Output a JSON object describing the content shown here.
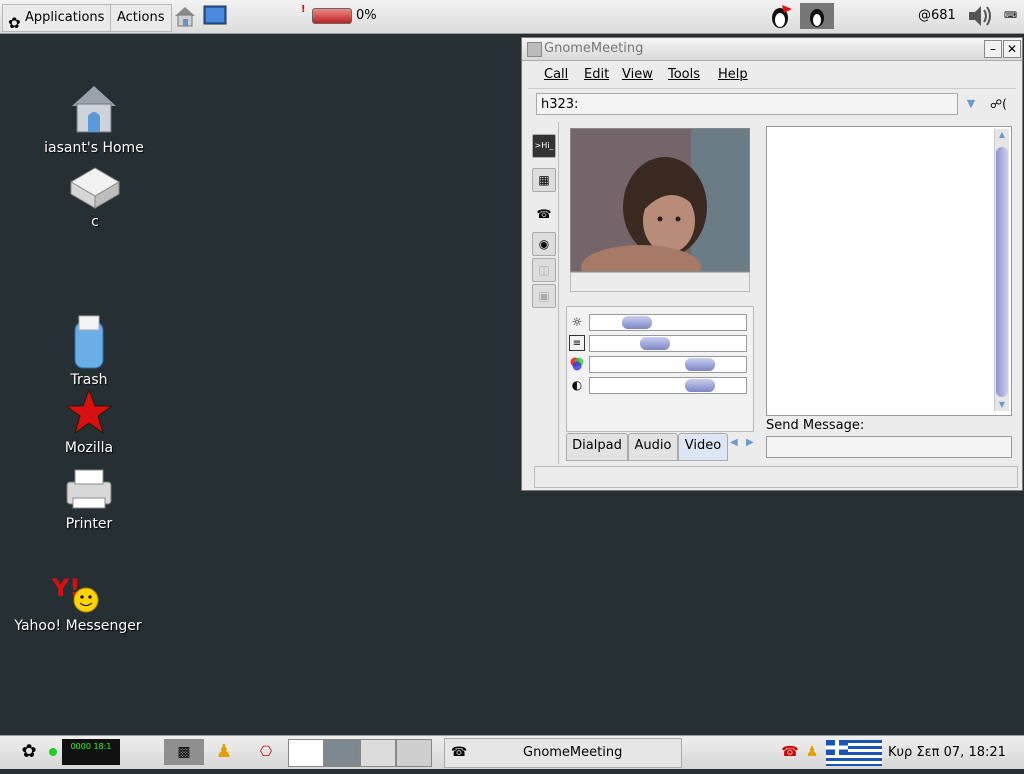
{
  "top_panel": {
    "applications_label": "Applications",
    "actions_label": "Actions",
    "battery_percent": "0%",
    "battery_level": 0,
    "net_label": "@681"
  },
  "desktop": {
    "icons": [
      {
        "label": "iasant's Home"
      },
      {
        "label": "c"
      },
      {
        "label": "Trash"
      },
      {
        "label": "Mozilla"
      },
      {
        "label": "Printer"
      },
      {
        "label": "Yahoo! Messenger"
      }
    ]
  },
  "window": {
    "title": "GnomeMeeting",
    "menu": [
      "Call",
      "Edit",
      "View",
      "Tools",
      "Help"
    ],
    "address_value": "h323:",
    "tabs": [
      "Dialpad",
      "Audio",
      "Video"
    ],
    "active_tab": "Video",
    "send_label": "Send Message:",
    "sliders": [
      {
        "icon": "brightness-icon",
        "value": 0.25
      },
      {
        "icon": "whiteness-icon",
        "value": 0.4
      },
      {
        "icon": "colour-icon",
        "value": 0.75
      },
      {
        "icon": "contrast-icon",
        "value": 0.75
      }
    ]
  },
  "bottom_panel": {
    "task_label": "GnomeMeeting",
    "clock": "Κυρ Σεπ 07, 18:21",
    "cpu_label": "0000 18:1"
  }
}
